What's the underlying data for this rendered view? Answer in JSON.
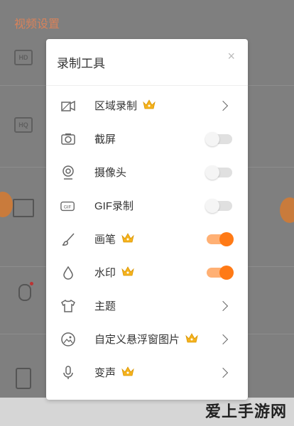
{
  "background": {
    "title": "视频设置",
    "icons": [
      {
        "name": "hd-icon",
        "text": "HD"
      },
      {
        "name": "hq-icon",
        "text": "HQ"
      }
    ]
  },
  "modal": {
    "title": "录制工具",
    "close": "×",
    "rows": [
      {
        "label": "区域录制",
        "crown": true,
        "control": "chevron",
        "icon": "region-record-icon"
      },
      {
        "label": "截屏",
        "crown": false,
        "control": "toggle",
        "on": false,
        "icon": "camera-icon"
      },
      {
        "label": "摄像头",
        "crown": false,
        "control": "toggle",
        "on": false,
        "icon": "webcam-icon"
      },
      {
        "label": "GIF录制",
        "crown": false,
        "control": "toggle",
        "on": false,
        "icon": "gif-icon"
      },
      {
        "label": "画笔",
        "crown": true,
        "control": "toggle",
        "on": true,
        "icon": "brush-icon"
      },
      {
        "label": "水印",
        "crown": true,
        "control": "toggle",
        "on": true,
        "icon": "watermark-drop-icon"
      },
      {
        "label": "主题",
        "crown": false,
        "control": "chevron",
        "icon": "tshirt-icon"
      },
      {
        "label": "自定义悬浮窗图片",
        "crown": true,
        "control": "chevron",
        "icon": "image-icon"
      },
      {
        "label": "变声",
        "crown": true,
        "control": "chevron",
        "icon": "voice-changer-icon"
      }
    ]
  },
  "watermark": "爱上手游网",
  "colors": {
    "accent": "#ff7a16",
    "accent_track": "#ffb074",
    "crown": "#f5b21d"
  }
}
